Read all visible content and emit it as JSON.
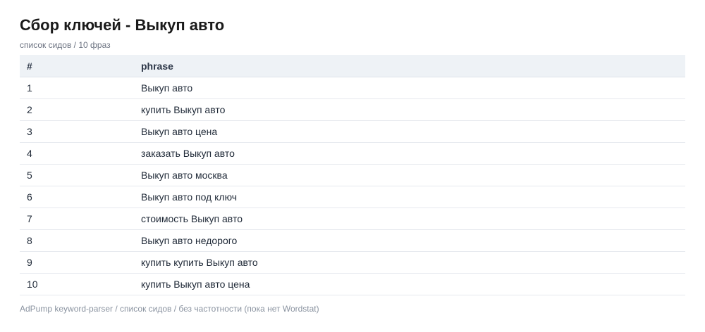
{
  "header": {
    "title": "Сбор ключей - Выкуп авто",
    "subtitle": "список сидов / 10 фраз"
  },
  "table": {
    "columns": [
      "#",
      "phrase"
    ],
    "rows": [
      {
        "num": "1",
        "phrase": "Выкуп авто"
      },
      {
        "num": "2",
        "phrase": "купить Выкуп авто"
      },
      {
        "num": "3",
        "phrase": "Выкуп авто цена"
      },
      {
        "num": "4",
        "phrase": "заказать Выкуп авто"
      },
      {
        "num": "5",
        "phrase": "Выкуп авто москва"
      },
      {
        "num": "6",
        "phrase": "Выкуп авто под ключ"
      },
      {
        "num": "7",
        "phrase": "стоимость Выкуп авто"
      },
      {
        "num": "8",
        "phrase": "Выкуп авто недорого"
      },
      {
        "num": "9",
        "phrase": "купить купить Выкуп авто"
      },
      {
        "num": "10",
        "phrase": "купить Выкуп авто цена"
      }
    ]
  },
  "footer": {
    "text": "AdPump keyword-parser / список сидов / без частотности (пока нет Wordstat)"
  }
}
